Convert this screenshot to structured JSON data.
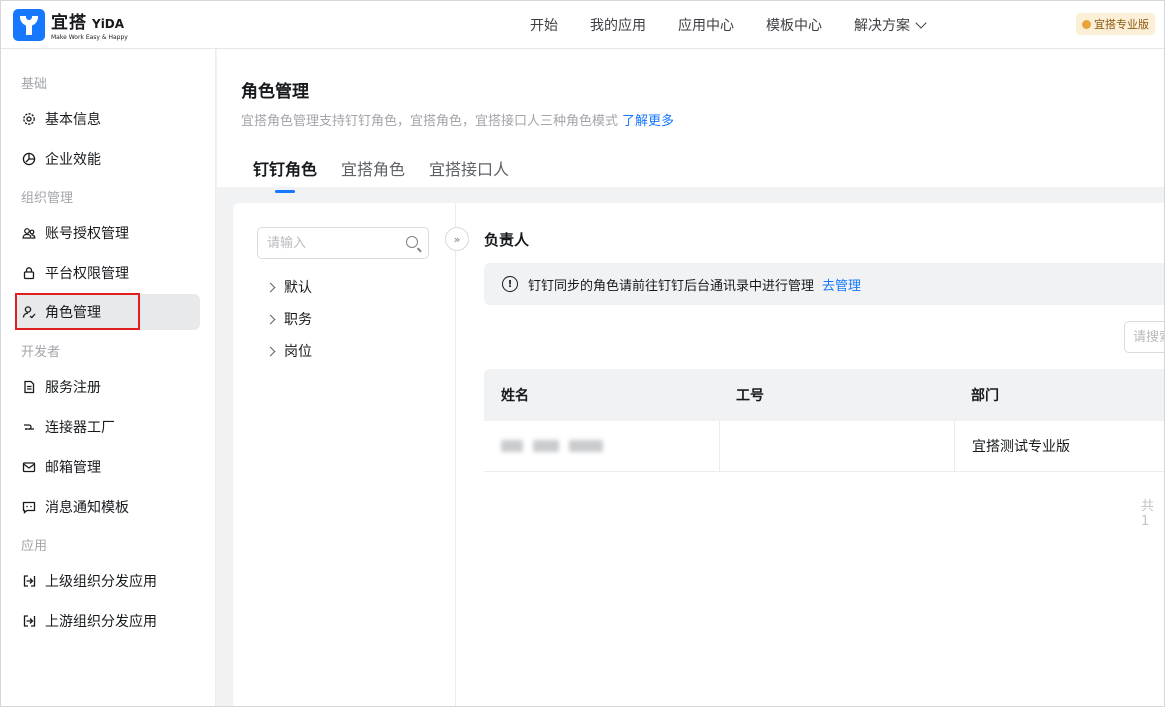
{
  "header": {
    "logo_cn": "宜搭",
    "logo_en": "YiDA",
    "logo_slogan": "Make Work Easy & Happy",
    "nav": [
      "开始",
      "我的应用",
      "应用中心",
      "模板中心",
      "解决方案"
    ],
    "pro_badge": "宜搭专业版"
  },
  "sidebar": {
    "groups": [
      {
        "title": "基础",
        "items": [
          {
            "label": "基本信息",
            "icon": "gear-icon"
          },
          {
            "label": "企业效能",
            "icon": "chart-icon"
          }
        ]
      },
      {
        "title": "组织管理",
        "items": [
          {
            "label": "账号授权管理",
            "icon": "users-icon"
          },
          {
            "label": "平台权限管理",
            "icon": "lock-icon"
          },
          {
            "label": "角色管理",
            "icon": "user-role-icon",
            "active": true
          }
        ]
      },
      {
        "title": "开发者",
        "items": [
          {
            "label": "服务注册",
            "icon": "document-icon"
          },
          {
            "label": "连接器工厂",
            "icon": "connector-icon"
          },
          {
            "label": "邮箱管理",
            "icon": "mail-icon"
          },
          {
            "label": "消息通知模板",
            "icon": "message-icon"
          }
        ]
      },
      {
        "title": "应用",
        "items": [
          {
            "label": "上级组织分发应用",
            "icon": "distribute-icon"
          },
          {
            "label": "上游组织分发应用",
            "icon": "distribute-icon"
          }
        ]
      }
    ]
  },
  "page": {
    "title": "角色管理",
    "description": "宜搭角色管理支持钉钉角色，宜搭角色，宜搭接口人三种角色模式",
    "learn_more": "了解更多",
    "tabs": [
      "钉钉角色",
      "宜搭角色",
      "宜搭接口人"
    ],
    "active_tab": 0
  },
  "tree": {
    "search_placeholder": "请输入",
    "items": [
      "默认",
      "职务",
      "岗位"
    ]
  },
  "detail": {
    "title": "负责人",
    "notice": "钉钉同步的角色请前往钉钉后台通讯录中进行管理",
    "notice_link": "去管理",
    "search_placeholder": "请搜索",
    "columns": [
      "姓名",
      "工号",
      "部门"
    ],
    "rows": [
      {
        "name": "",
        "employee_id": "",
        "department": "宜搭测试专业版"
      }
    ],
    "total_text": "共 1"
  }
}
